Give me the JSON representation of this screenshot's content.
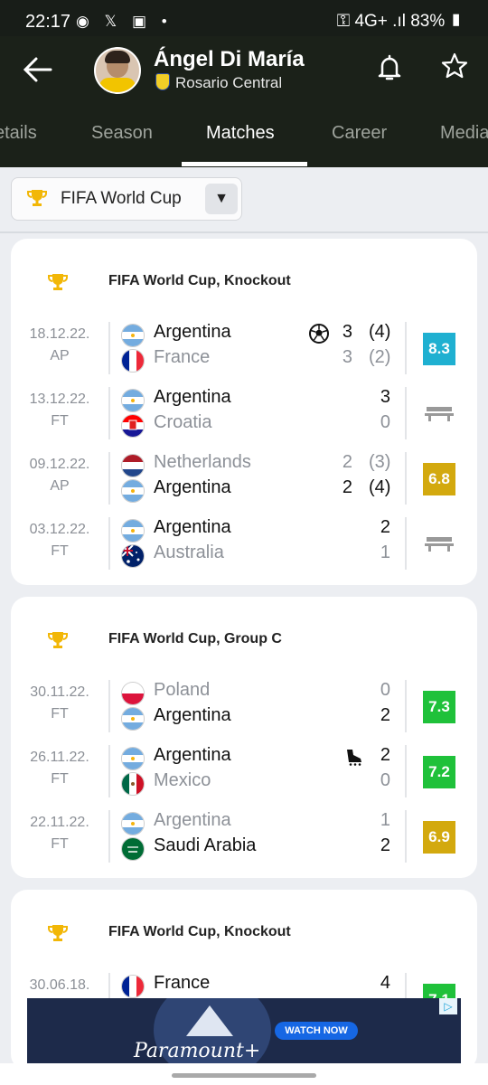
{
  "status_bar": {
    "time": "22:17",
    "notif": "◉ 𝕏 ▣ •",
    "right": "⚿ 4G+ .ıl 83% ▮"
  },
  "header": {
    "player_name": "Ángel Di María",
    "club": "Rosario Central"
  },
  "tabs": [
    {
      "label": "etails",
      "active": false
    },
    {
      "label": "Season",
      "active": false
    },
    {
      "label": "Matches",
      "active": true
    },
    {
      "label": "Career",
      "active": false
    },
    {
      "label": "Media",
      "active": false
    }
  ],
  "filter": {
    "label": "FIFA World Cup"
  },
  "colors": {
    "rating_blue": "#1fb0d1",
    "rating_gold": "#d3a90e",
    "rating_green": "#1fc13a"
  },
  "cards": [
    {
      "title": "FIFA World Cup, Knockout",
      "matches": [
        {
          "date": "18.12.22.",
          "status": "AP",
          "home": {
            "name": "Argentina",
            "flag": "argentina",
            "score": "3",
            "pen": "(4)",
            "win": true
          },
          "away": {
            "name": "France",
            "flag": "france",
            "score": "3",
            "pen": "(2)",
            "win": false
          },
          "event": "ball-icon",
          "rating": "8.3",
          "rating_color": "#1fb0d1"
        },
        {
          "date": "13.12.22.",
          "status": "FT",
          "home": {
            "name": "Argentina",
            "flag": "argentina",
            "score": "3",
            "pen": "",
            "win": true
          },
          "away": {
            "name": "Croatia",
            "flag": "croatia",
            "score": "0",
            "pen": "",
            "win": false
          },
          "event": "",
          "rating": "",
          "bench": true
        },
        {
          "date": "09.12.22.",
          "status": "AP",
          "home": {
            "name": "Netherlands",
            "flag": "netherlands",
            "score": "2",
            "pen": "(3)",
            "win": false
          },
          "away": {
            "name": "Argentina",
            "flag": "argentina",
            "score": "2",
            "pen": "(4)",
            "win": true
          },
          "event": "",
          "rating": "6.8",
          "rating_color": "#d3a90e"
        },
        {
          "date": "03.12.22.",
          "status": "FT",
          "home": {
            "name": "Argentina",
            "flag": "argentina",
            "score": "2",
            "pen": "",
            "win": true
          },
          "away": {
            "name": "Australia",
            "flag": "australia",
            "score": "1",
            "pen": "",
            "win": false
          },
          "event": "",
          "rating": "",
          "bench": true
        }
      ]
    },
    {
      "title": "FIFA World Cup, Group C",
      "matches": [
        {
          "date": "30.11.22.",
          "status": "FT",
          "home": {
            "name": "Poland",
            "flag": "poland",
            "score": "0",
            "pen": "",
            "win": false
          },
          "away": {
            "name": "Argentina",
            "flag": "argentina",
            "score": "2",
            "pen": "",
            "win": true
          },
          "event": "",
          "rating": "7.3",
          "rating_color": "#1fc13a"
        },
        {
          "date": "26.11.22.",
          "status": "FT",
          "home": {
            "name": "Argentina",
            "flag": "argentina",
            "score": "2",
            "pen": "",
            "win": true
          },
          "away": {
            "name": "Mexico",
            "flag": "mexico",
            "score": "0",
            "pen": "",
            "win": false
          },
          "event": "boot-icon",
          "rating": "7.2",
          "rating_color": "#1fc13a"
        },
        {
          "date": "22.11.22.",
          "status": "FT",
          "home": {
            "name": "Argentina",
            "flag": "argentina",
            "score": "1",
            "pen": "",
            "win": false
          },
          "away": {
            "name": "Saudi Arabia",
            "flag": "saudi",
            "score": "2",
            "pen": "",
            "win": true
          },
          "event": "",
          "rating": "6.9",
          "rating_color": "#d3a90e"
        }
      ]
    },
    {
      "title": "FIFA World Cup, Knockout",
      "matches": [
        {
          "date": "30.06.18.",
          "status": "",
          "home": {
            "name": "France",
            "flag": "france",
            "score": "4",
            "pen": "",
            "win": true
          },
          "away": {
            "name": "",
            "flag": "",
            "score": "",
            "pen": "",
            "win": false
          },
          "event": "",
          "rating": "7.1",
          "rating_color": "#1fc13a"
        }
      ]
    }
  ],
  "ad": {
    "brand": "Paramount+",
    "cta": "WATCH NOW",
    "info": "▷"
  }
}
